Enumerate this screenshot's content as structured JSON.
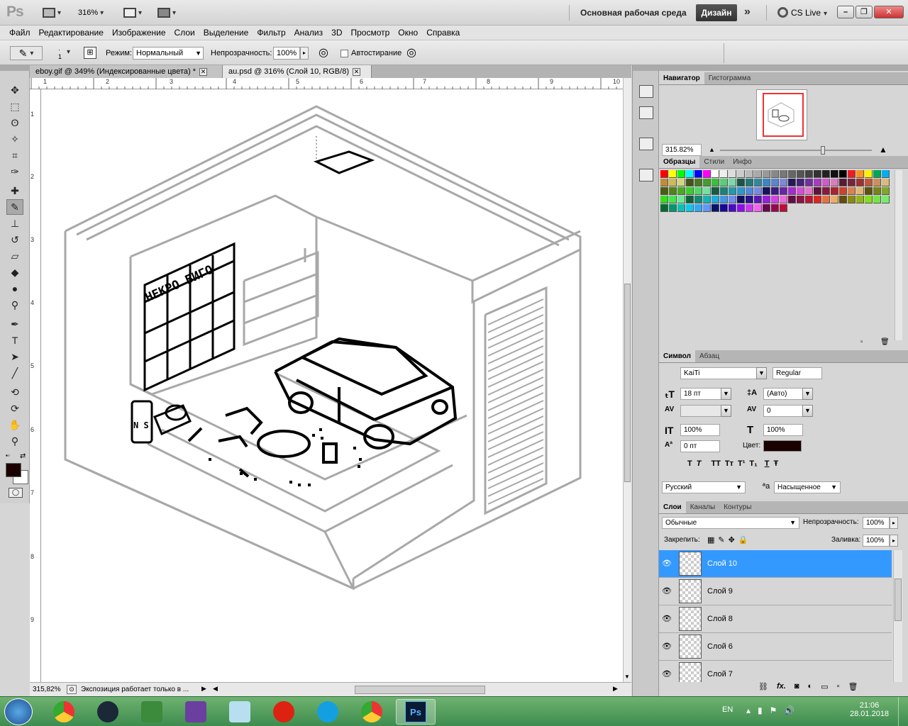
{
  "app": {
    "logo": "Ps",
    "zoom": "316%",
    "workspace_label": "Основная рабочая среда",
    "design_button": "Дизайн",
    "cs_live": "CS Live"
  },
  "menu": [
    "Файл",
    "Редактирование",
    "Изображение",
    "Слои",
    "Выделение",
    "Фильтр",
    "Анализ",
    "3D",
    "Просмотр",
    "Окно",
    "Справка"
  ],
  "options": {
    "brush_size": "1",
    "mode_label": "Режим:",
    "mode_value": "Нормальный",
    "opacity_label": "Непрозрачность:",
    "opacity_value": "100%",
    "autoerase_label": "Автостирание"
  },
  "tabs": [
    {
      "label": "eboy.gif @ 349% (Индексированные цвета) *"
    },
    {
      "label": "au.psd @ 316% (Слой 10, RGB/8)"
    }
  ],
  "ruler": {
    "top": [
      "1",
      "2",
      "3",
      "4",
      "5",
      "6",
      "7",
      "8",
      "9",
      "10"
    ],
    "left": [
      "1",
      "2",
      "3",
      "4",
      "5",
      "6",
      "7",
      "8",
      "9"
    ]
  },
  "canvas": {
    "sign_text": "НЕКРО БИГО",
    "bottle_label": "N S"
  },
  "status": {
    "zoom": "315,82%",
    "message": "Экспозиция работает только в ..."
  },
  "navigator": {
    "tabs": [
      "Навигатор",
      "Гистограмма"
    ],
    "zoom": "315.82%"
  },
  "swatches": {
    "tabs": [
      "Образцы",
      "Стили",
      "Инфо"
    ]
  },
  "character": {
    "tabs": [
      "Символ",
      "Абзац"
    ],
    "font_family": "KaiTi",
    "font_style": "Regular",
    "font_size": "18 пт",
    "leading": "(Авто)",
    "tracking": "0",
    "vscale": "100%",
    "hscale": "100%",
    "baseline": "0 пт",
    "color_label": "Цвет:",
    "language": "Русский",
    "antialias": "Насыщенное",
    "antialias_prefix": "ªa",
    "style_buttons": [
      "T",
      "T",
      "TT",
      "Tт",
      "T¹",
      "T₁",
      "T",
      "Ŧ"
    ]
  },
  "layers": {
    "tabs": [
      "Слои",
      "Каналы",
      "Контуры"
    ],
    "blend_mode": "Обычные",
    "opacity_label": "Непрозрачность:",
    "opacity_value": "100%",
    "lock_label": "Закрепить:",
    "fill_label": "Заливка:",
    "fill_value": "100%",
    "items": [
      {
        "name": "Слой 10",
        "selected": true
      },
      {
        "name": "Слой 9"
      },
      {
        "name": "Слой 8"
      },
      {
        "name": "Слой 6"
      },
      {
        "name": "Слой 7"
      }
    ]
  },
  "taskbar": {
    "lang": "EN",
    "time": "21:06",
    "date": "28.01.2018",
    "ps_label": "Ps"
  },
  "colors": {
    "accent": "#3399ff",
    "foreground": "#1a0000"
  }
}
